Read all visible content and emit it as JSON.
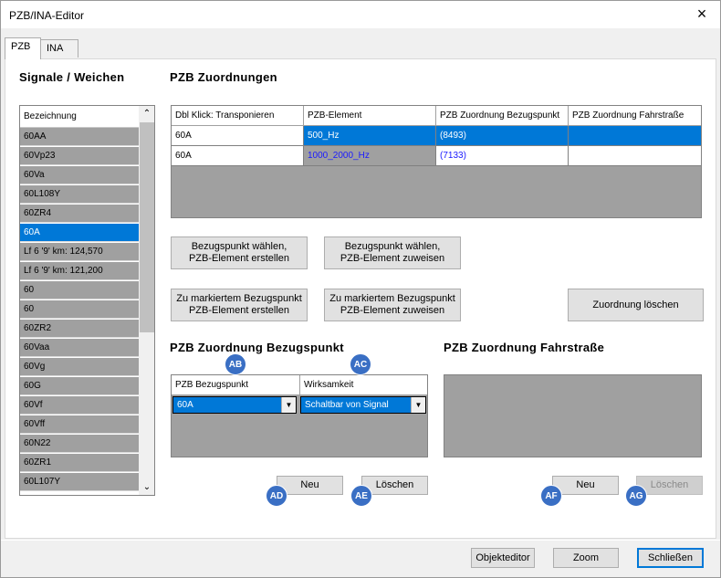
{
  "window": {
    "title": "PZB/INA-Editor",
    "close_icon": "×"
  },
  "tabs": [
    {
      "label": "PZB"
    },
    {
      "label": "INA"
    }
  ],
  "left": {
    "heading": "Signale / Weichen",
    "list_header": "Bezeichnung",
    "items": [
      "60AA",
      "60Vp23",
      "60Va",
      "60L108Y",
      "60ZR4",
      "60A",
      "Lf 6 '9' km: 124,570",
      "Lf 6 '9' km: 121,200",
      "60",
      "60",
      "60ZR2",
      "60Vaa",
      "60Vg",
      "60G",
      "60Vf",
      "60Vff",
      "60N22",
      "60ZR1",
      "60L107Y"
    ],
    "selected_index": 5
  },
  "assignments": {
    "heading": "PZB Zuordnungen",
    "columns": [
      "Dbl Klick: Transponieren",
      "PZB-Element",
      "PZB Zuordnung Bezugspunkt",
      "PZB Zuordnung Fahrstraße"
    ],
    "rows": [
      [
        "60A",
        "500_Hz",
        "(8493)",
        ""
      ],
      [
        "60A",
        "1000_2000_Hz",
        "(7133)",
        ""
      ]
    ]
  },
  "buttons": {
    "choose_create": "Bezugspunkt wählen,\nPZB-Element erstellen",
    "choose_assign": "Bezugspunkt wählen,\nPZB-Element zuweisen",
    "marked_create": "Zu markiertem Bezugspunkt\nPZB-Element erstellen",
    "marked_assign": "Zu markiertem Bezugspunkt\nPZB-Element zuweisen",
    "delete_assignment": "Zuordnung löschen"
  },
  "ref_point": {
    "heading": "PZB Zuordnung Bezugspunkt",
    "columns": [
      "PZB Bezugspunkt",
      "Wirksamkeit"
    ],
    "row": {
      "ref": "60A",
      "effect": "Schaltbar von Signal"
    },
    "new": "Neu",
    "delete": "Löschen"
  },
  "route": {
    "heading": "PZB Zuordnung Fahrstraße",
    "new": "Neu",
    "delete": "Löschen"
  },
  "badges": {
    "ab": "AB",
    "ac": "AC",
    "ad": "AD",
    "ae": "AE",
    "af": "AF",
    "ag": "AG"
  },
  "footer": {
    "object_editor": "Objekteditor",
    "zoom": "Zoom",
    "close": "Schließen"
  }
}
